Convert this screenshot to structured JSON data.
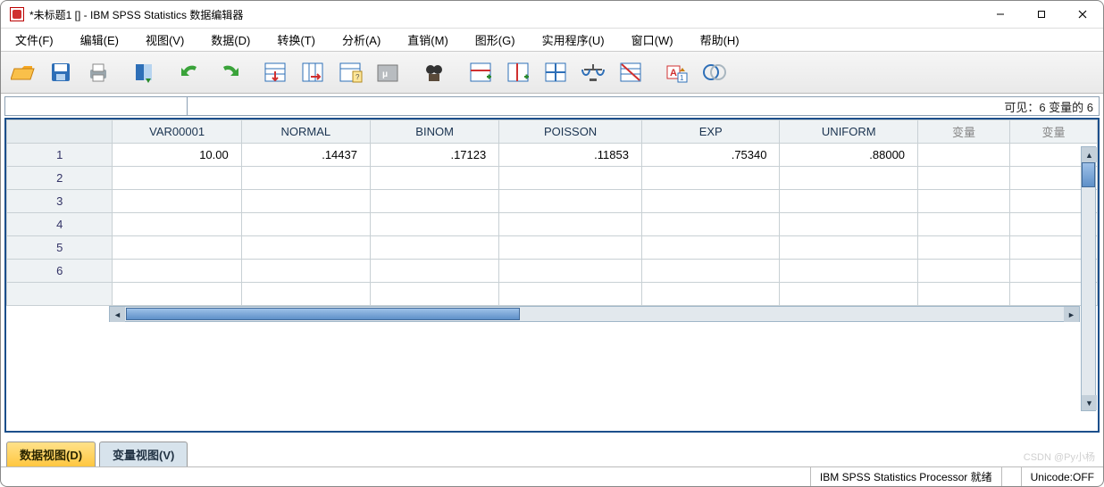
{
  "window": {
    "title": "*未标题1 [] - IBM SPSS Statistics 数据编辑器"
  },
  "menu": {
    "file": "文件(F)",
    "edit": "编辑(E)",
    "view": "视图(V)",
    "data": "数据(D)",
    "transform": "转换(T)",
    "analyze": "分析(A)",
    "direct": "直销(M)",
    "graphs": "图形(G)",
    "utilities": "实用程序(U)",
    "window": "窗口(W)",
    "help": "帮助(H)"
  },
  "info": {
    "visible": "可见：6 变量的 6"
  },
  "columns": {
    "c1": "VAR00001",
    "c2": "NORMAL",
    "c3": "BINOM",
    "c4": "POISSON",
    "c5": "EXP",
    "c6": "UNIFORM",
    "empty": "变量"
  },
  "rows": {
    "r1": "1",
    "r2": "2",
    "r3": "3",
    "r4": "4",
    "r5": "5",
    "r6": "6"
  },
  "cells": {
    "r1c1": "10.00",
    "r1c2": ".14437",
    "r1c3": ".17123",
    "r1c4": ".11853",
    "r1c5": ".75340",
    "r1c6": ".88000"
  },
  "tabs": {
    "data": "数据视图(D)",
    "var": "变量视图(V)"
  },
  "status": {
    "processor": "IBM SPSS Statistics Processor 就绪",
    "unicode": "Unicode:OFF"
  },
  "watermark": "CSDN @Py小杨"
}
